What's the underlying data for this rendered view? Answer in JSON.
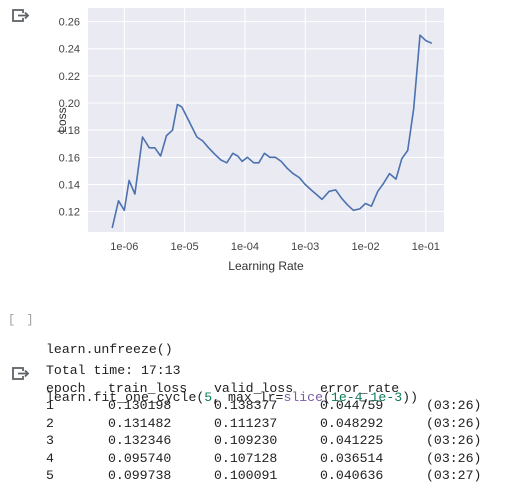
{
  "chart_data": {
    "type": "line",
    "xlabel": "Learning Rate",
    "ylabel": "Loss",
    "xscale": "log",
    "x_ticks": [
      1e-06,
      1e-05,
      0.0001,
      0.001,
      0.01,
      0.1
    ],
    "x_tick_labels": [
      "1e-06",
      "1e-05",
      "1e-04",
      "1e-03",
      "1e-02",
      "1e-01"
    ],
    "y_ticks": [
      0.12,
      0.14,
      0.16,
      0.18,
      0.2,
      0.22,
      0.24,
      0.26
    ],
    "y_tick_labels": [
      "0.12",
      "0.14",
      "0.16",
      "0.18",
      "0.20",
      "0.22",
      "0.24",
      "0.26"
    ],
    "xlim": [
      2.5e-07,
      0.2
    ],
    "ylim": [
      0.105,
      0.27
    ],
    "grid": true,
    "series_color": "#4c72b0",
    "x": [
      6.3e-07,
      8e-07,
      1e-06,
      1.2e-06,
      1.5e-06,
      2e-06,
      2.6e-06,
      3.2e-06,
      4e-06,
      5e-06,
      6.3e-06,
      7.6e-06,
      9e-06,
      1.2e-05,
      1.6e-05,
      2e-05,
      2.5e-05,
      3.2e-05,
      4e-05,
      5e-05,
      6.3e-05,
      7.6e-05,
      9e-05,
      0.00011,
      0.00014,
      0.00017,
      0.00021,
      0.00026,
      0.00032,
      0.0004,
      0.0005,
      0.00063,
      0.0008,
      0.001,
      0.00125,
      0.0015,
      0.0019,
      0.0025,
      0.0032,
      0.004,
      0.005,
      0.0063,
      0.008,
      0.01,
      0.0125,
      0.016,
      0.02,
      0.025,
      0.032,
      0.04,
      0.05,
      0.063,
      0.08,
      0.1,
      0.126
    ],
    "y": [
      0.108,
      0.128,
      0.121,
      0.143,
      0.133,
      0.175,
      0.167,
      0.167,
      0.161,
      0.176,
      0.18,
      0.199,
      0.197,
      0.186,
      0.175,
      0.172,
      0.167,
      0.162,
      0.158,
      0.156,
      0.163,
      0.161,
      0.157,
      0.16,
      0.156,
      0.156,
      0.163,
      0.16,
      0.16,
      0.157,
      0.152,
      0.148,
      0.145,
      0.14,
      0.136,
      0.133,
      0.129,
      0.135,
      0.136,
      0.13,
      0.125,
      0.121,
      0.122,
      0.126,
      0.124,
      0.135,
      0.141,
      0.148,
      0.144,
      0.159,
      0.165,
      0.196,
      0.25,
      0.246,
      0.244,
      0.248,
      0.263,
      0.25
    ]
  },
  "code_cell": {
    "run_button": "[ ]",
    "lines": [
      "learn.unfreeze()",
      "learn.fit_one_cycle(5, max_lr=slice(1e-4,1e-3))"
    ]
  },
  "training_output": {
    "total_time": "Total time: 17:13",
    "headers": [
      "epoch",
      "train_loss",
      "valid_loss",
      "error_rate",
      ""
    ],
    "rows": [
      [
        "1",
        "0.130198",
        "0.138377",
        "0.044759",
        "(03:26)"
      ],
      [
        "2",
        "0.131482",
        "0.111237",
        "0.048292",
        "(03:26)"
      ],
      [
        "3",
        "0.132346",
        "0.109230",
        "0.041225",
        "(03:26)"
      ],
      [
        "4",
        "0.095740",
        "0.107128",
        "0.036514",
        "(03:26)"
      ],
      [
        "5",
        "0.099738",
        "0.100091",
        "0.040636",
        "(03:27)"
      ]
    ]
  },
  "icons": {
    "output_icon": "output-arrow-icon"
  }
}
